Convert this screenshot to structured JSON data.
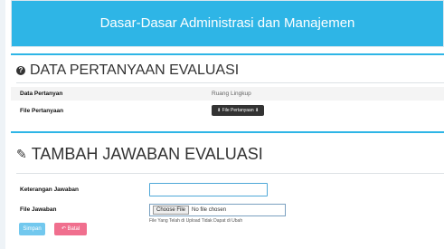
{
  "header": {
    "title": "Dasar-Dasar Administrasi dan Manajemen"
  },
  "section1": {
    "title": "DATA PERTANYAAN EVALUASI",
    "rows": [
      {
        "label": "Data Pertanyan",
        "value": "Ruang Lingkup"
      },
      {
        "label": "File Pertanyaan",
        "button": "⬇ File Pertanyaan ⬇"
      }
    ]
  },
  "section2": {
    "title": "TAMBAH JAWABAN EVALUASI",
    "keterangan_label": "Keterangan Jawaban",
    "keterangan_value": "",
    "file_label": "File Jawaban",
    "choose_file": "Choose File",
    "no_file": "No file chosen",
    "help": "File Yang Telah di Upload Tidak Dapat di Ubah"
  },
  "buttons": {
    "save": "Simpan",
    "reset": "↶ Batal"
  },
  "colors": {
    "accent": "#2eb5e6",
    "save": "#72c8ee",
    "reset": "#f06f8e"
  }
}
